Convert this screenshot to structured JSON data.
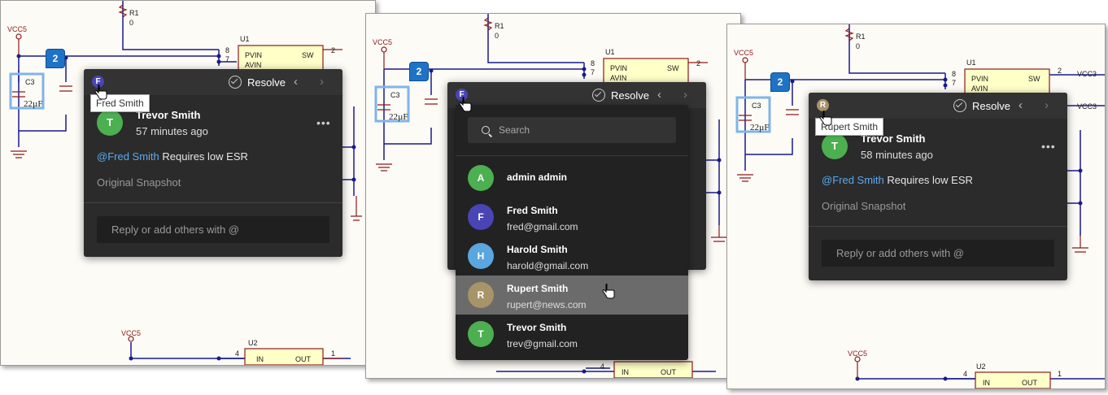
{
  "schematic": {
    "vcc_label": "VCC5",
    "r1_label": "R1",
    "r1_value": "0",
    "u1_label": "U1",
    "u2_label": "U2",
    "c3_label": "C3",
    "c3_value": "22µF",
    "pin_pvin": "PVIN",
    "pin_avin": "AVIN",
    "pin_sw": "SW",
    "pin_in": "IN",
    "pin_out": "OUT",
    "pin_8": "8",
    "pin_7": "7",
    "pin_2": "2",
    "pin_4": "4",
    "pin_1": "1",
    "vcc3_label": "VCC3"
  },
  "panel1": {
    "badge": "2",
    "avatar_letter": "F",
    "tooltip": "Fred Smith",
    "resolve_label": "Resolve",
    "prev_icon": "chevron-left-icon",
    "next_icon": "chevron-right-icon",
    "author_letter": "T",
    "author_name": "Trevor Smith",
    "time_ago": "57 minutes ago",
    "more": "•••",
    "mention": "@Fred Smith",
    "message": " Requires low ESR",
    "snapshot": "Original Snapshot",
    "reply_placeholder": "Reply or add others with @"
  },
  "panel2": {
    "badge": "2",
    "avatar_letter": "F",
    "resolve_label": "Resolve",
    "search_placeholder": "Search",
    "users": [
      {
        "letter": "A",
        "name": "admin admin",
        "email": "",
        "color": "#4caf50"
      },
      {
        "letter": "F",
        "name": "Fred Smith",
        "email": "fred@gmail.com",
        "color": "#4a45b5"
      },
      {
        "letter": "H",
        "name": "Harold Smith",
        "email": "harold@gmail.com",
        "color": "#5aa6de"
      },
      {
        "letter": "R",
        "name": "Rupert Smith",
        "email": "rupert@news.com",
        "color": "#a89469"
      },
      {
        "letter": "T",
        "name": "Trevor Smith",
        "email": "trev@gmail.com",
        "color": "#4caf50"
      }
    ],
    "highlighted_index": 3
  },
  "panel3": {
    "badge": "2",
    "avatar_letter": "R",
    "tooltip": "Rupert Smith",
    "resolve_label": "Resolve",
    "author_letter": "T",
    "author_name": "Trevor Smith",
    "time_ago": "58 minutes ago",
    "more": "•••",
    "mention": "@Fred Smith",
    "message": " Requires low ESR",
    "snapshot": "Original Snapshot",
    "reply_placeholder": "Reply or add others with @"
  },
  "colors": {
    "fred": "#4a45b5",
    "rupert": "#a89469",
    "trevor": "#4caf50",
    "wire": "#1a1a8c",
    "component": "#8b1a1a"
  }
}
